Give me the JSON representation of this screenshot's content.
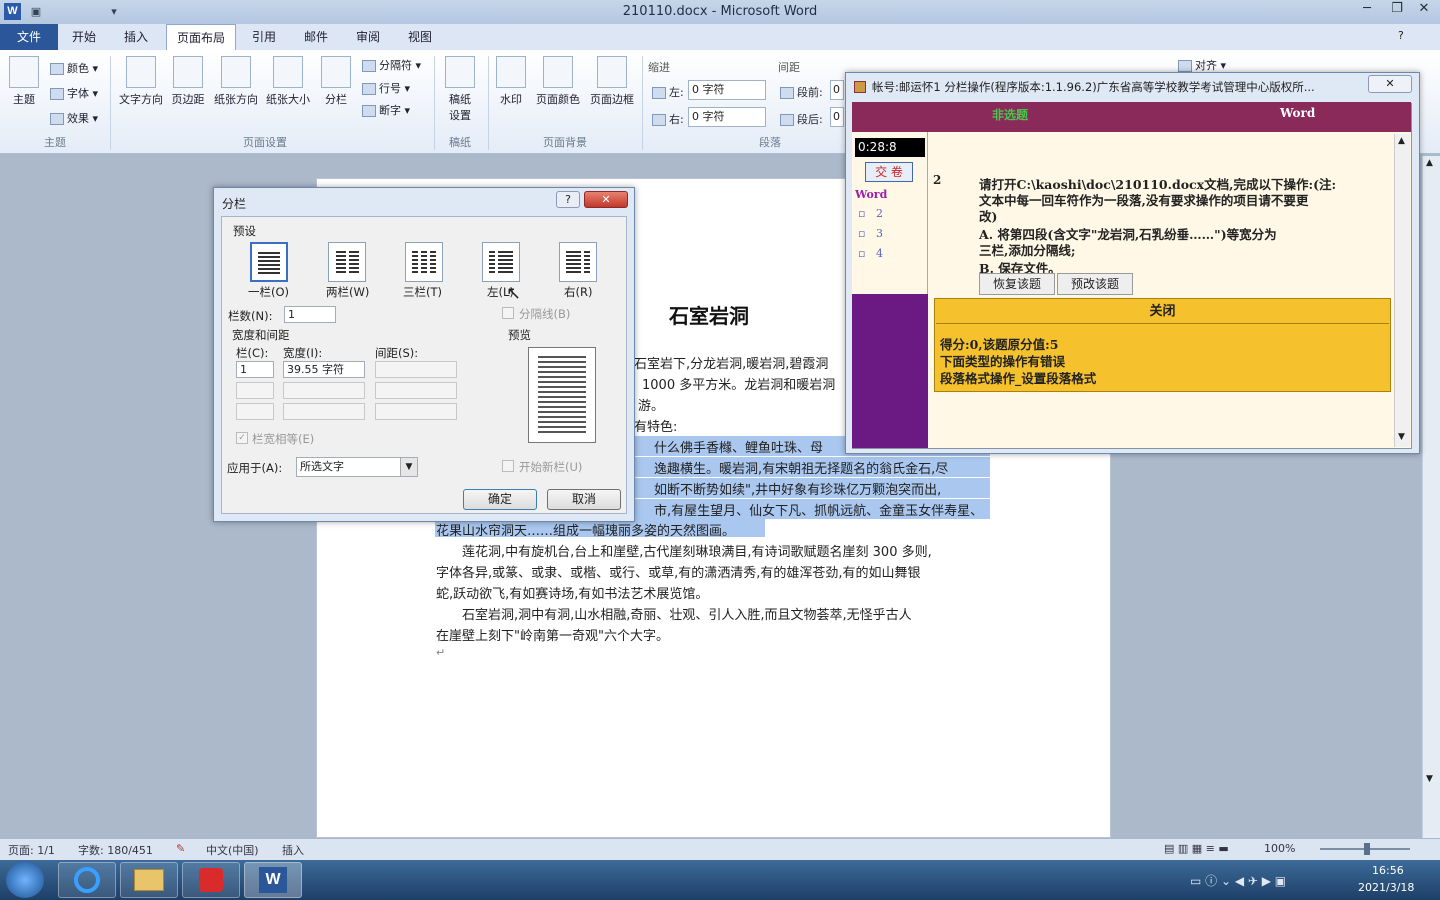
{
  "window": {
    "title": "210110.docx - Microsoft Word",
    "app_icon": "W"
  },
  "tabs": [
    "文件",
    "开始",
    "插入",
    "页面布局",
    "引用",
    "邮件",
    "审阅",
    "视图"
  ],
  "ribbon": {
    "themes": {
      "big": "主题",
      "colors": "颜色",
      "fonts": "字体",
      "effects": "效果",
      "group": "主题"
    },
    "page_setup": {
      "items": [
        "文字方向",
        "页边距",
        "纸张方向",
        "纸张大小",
        "分栏"
      ],
      "breaks": "分隔符",
      "line_numbers": "行号",
      "hyphenation": "断字",
      "group": "页面设置"
    },
    "draft": {
      "label": "稿纸\n设置",
      "label1": "稿纸",
      "label2": "设置",
      "group": "稿纸"
    },
    "background": {
      "items": [
        "水印",
        "页面颜色",
        "页面边框"
      ],
      "group": "页面背景"
    },
    "paragraph": {
      "indent": "缩进",
      "spacing": "间距",
      "left": "左:",
      "right": "右:",
      "left_val": "0 字符",
      "right_val": "0 字符",
      "before": "段前:",
      "after": "段后:",
      "before_val": "0",
      "after_val": "0",
      "group": "段落"
    },
    "arrange": {
      "align": "对齐"
    }
  },
  "document": {
    "title": "石室岩洞",
    "lines": [
      "石室岩下,分龙岩洞,暖岩洞,碧霞洞",
      "1000 多平方米。龙岩洞和暖岩洞",
      "游。",
      "有特色:",
      "什么佛手香橼、鲤鱼吐珠、母",
      "逸趣横生。暖岩洞,有宋朝祖无择题名的翁氏金石,尽",
      "如断不断势如续\",井中好象有珍珠亿万颗泡突而出,",
      "市,有屋生望月、仙女下凡、抓帆远航、金童玉女伴寿星、",
      "花果山水帘洞天……组成一幅瑰丽多姿的天然图画。",
      "莲花洞,中有旋机台,台上和崖壁,古代崖刻琳琅满目,有诗词歌赋题名崖刻 300 多则,",
      "字体各异,或篆、或隶、或楷、或行、或草,有的潇洒清秀,有的雄浑苍劲,有的如山舞银",
      "蛇,跃动欲飞,有如赛诗场,有如书法艺术展览馆。",
      "石室岩洞,洞中有洞,山水相融,奇丽、壮观、引人入胜,而且文物荟萃,无怪乎古人",
      "在崖壁上刻下\"岭南第一奇观\"六个大字。"
    ]
  },
  "dialog": {
    "title": "分栏",
    "help": "?",
    "preset_label": "预设",
    "presets": [
      "一栏(O)",
      "两栏(W)",
      "三栏(T)",
      "左(L)",
      "右(R)"
    ],
    "num_cols_label": "栏数(N):",
    "num_cols_value": "1",
    "divider_label": "分隔线(B)",
    "width_spacing_label": "宽度和间距",
    "col_header": "栏(C):",
    "width_header": "宽度(I):",
    "spacing_header": "间距(S):",
    "row1_col": "1",
    "row1_width": "39.55 字符",
    "equal_width_label": "栏宽相等(E)",
    "preview_label": "预览",
    "apply_label": "应用于(A):",
    "apply_value": "所选文字",
    "new_col_label": "开始新栏(U)",
    "ok": "确定",
    "cancel": "取消"
  },
  "exam": {
    "title": "帐号:邮运怀1  分栏操作(程序版本:1.1.96.2)广东省高等学校教学考试管理中心版权所...",
    "header_left": "非选题",
    "header_right": "Word",
    "timer": "0:28:8",
    "submit": "交 卷",
    "nav_title": "Word",
    "nav_items": [
      "2",
      "3",
      "4"
    ],
    "q_num": "2",
    "question_lines": [
      "请打开C:\\kaoshi\\doc\\210110.docx文档,完成以下操作:(注:",
      "文本中每一回车符作为一段落,没有要求操作的项目请不要更",
      "改)",
      "A. 将第四段(含文字\"龙岩洞,石乳纷垂……\")等宽分为",
      "三栏,添加分隔线;",
      "B. 保存文件。"
    ],
    "restore": "恢复该题",
    "redo": "预改该题",
    "close": "关闭",
    "result_lines": [
      "得分:0,该题原分值:5",
      "下面类型的操作有错误",
      "段落格式操作_设置段落格式"
    ]
  },
  "status": {
    "page": "页面: 1/1",
    "words": "字数: 180/451",
    "lang": "中文(中国)",
    "mode": "插入",
    "zoom": "100%"
  },
  "taskbar": {
    "time": "16:56",
    "date": "2021/3/18"
  },
  "colors": {
    "exam_header": "#8a2a5a",
    "exam_nav": "#6b1a84",
    "exam_panel": "#fff8e6",
    "exam_result": "#f5c22e",
    "selection": "#a9c7ef",
    "file_tab": "#2b579a"
  }
}
